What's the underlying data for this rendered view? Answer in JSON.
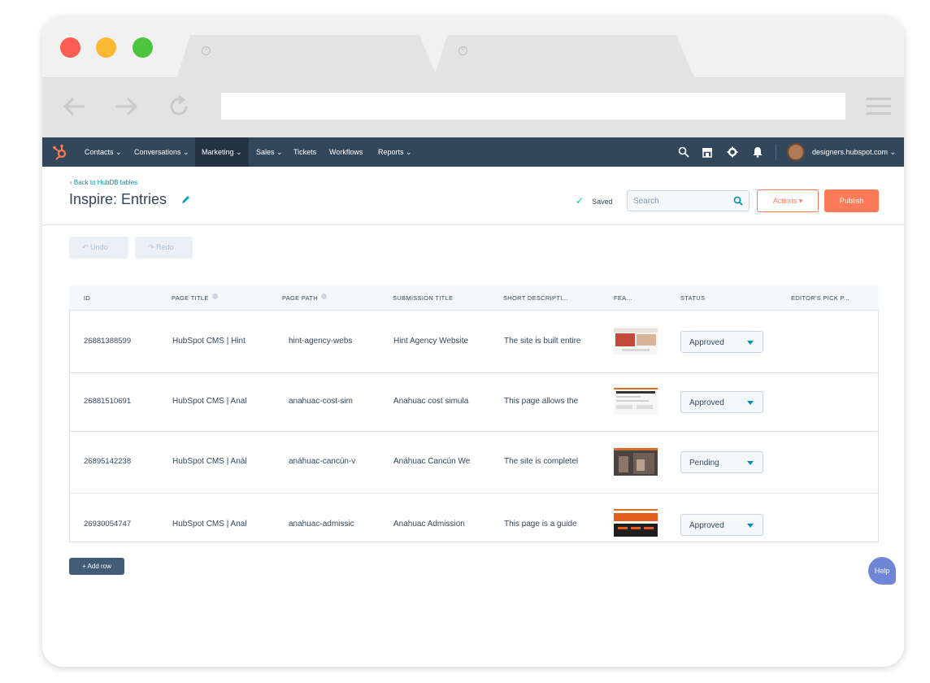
{
  "nav": {
    "items": [
      "Contacts",
      "Conversations",
      "Marketing",
      "Sales",
      "Tickets",
      "Workflows",
      "Reports"
    ],
    "account": "designers.hubspot.com"
  },
  "header": {
    "back_link": "Back to HubDB tables",
    "title": "Inspire: Entries",
    "saved": "Saved",
    "search_placeholder": "Search",
    "actions_label": "Actions",
    "publish_label": "Publish"
  },
  "toolbar": {
    "undo_label": "Undo",
    "redo_label": "Redo"
  },
  "table": {
    "columns": [
      "ID",
      "PAGE TITLE",
      "PAGE PATH",
      "SUBMISSION TITLE",
      "SHORT DESCRIPTI...",
      "FEA...",
      "STATUS",
      "EDITOR'S PICK P..."
    ],
    "rows": [
      {
        "id": "26881388599",
        "page_title": "HubSpot CMS | Hint",
        "page_path": "hint-agency-webs",
        "submission_title": "Hint Agency Website",
        "short_description": "The site is built entire",
        "status": "Approved"
      },
      {
        "id": "26881510691",
        "page_title": "HubSpot CMS | Anal",
        "page_path": "anahuac-cost-sim",
        "submission_title": "Anahuac cost simula",
        "short_description": "This page allows the",
        "status": "Approved"
      },
      {
        "id": "26895142238",
        "page_title": "HubSpot CMS | Anál",
        "page_path": "anáhuac-cancún-v",
        "submission_title": "Anáhuac Cancún We",
        "short_description": "The site is completel",
        "status": "Pending"
      },
      {
        "id": "26930054747",
        "page_title": "HubSpot CMS | Anal",
        "page_path": "anahuac-admissic",
        "submission_title": "Anahuac Admission",
        "short_description": "This page is a guide",
        "status": "Approved"
      }
    ]
  },
  "footer": {
    "add_row_label": "Add row",
    "help_label": "Help"
  },
  "colors": {
    "nav_bg": "#33475b",
    "accent": "#ff7a59",
    "link": "#0091ae"
  }
}
